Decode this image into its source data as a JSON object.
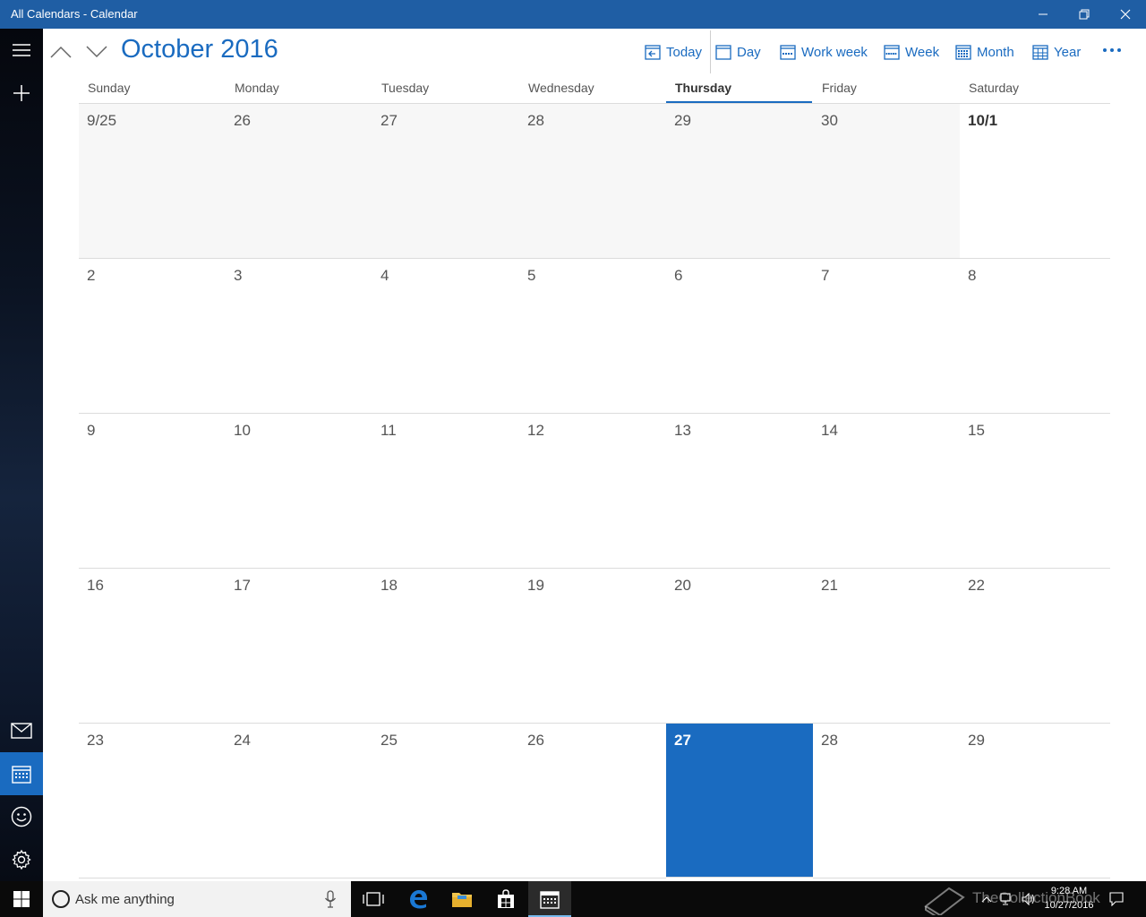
{
  "window": {
    "title": "All Calendars - Calendar",
    "controls": {
      "minimize": "minimize-icon",
      "restore": "restore-icon",
      "close": "close-icon"
    }
  },
  "rail": {
    "top": [
      "hamburger-menu-icon",
      "new-event-plus-icon"
    ],
    "bottom": [
      "mail-icon",
      "calendar-icon",
      "people-smiley-icon",
      "settings-gear-icon"
    ],
    "active": "calendar-icon"
  },
  "toolbar": {
    "month_title": "October 2016",
    "buttons": {
      "today": "Today",
      "day": "Day",
      "work_week": "Work week",
      "week": "Week",
      "month": "Month",
      "year": "Year"
    },
    "more": "more-ellipsis-icon"
  },
  "calendar": {
    "days_of_week": [
      "Sunday",
      "Monday",
      "Tuesday",
      "Wednesday",
      "Thursday",
      "Friday",
      "Saturday"
    ],
    "today_weekday": "Thursday",
    "weeks": [
      [
        "9/25",
        "26",
        "27",
        "28",
        "29",
        "30",
        "10/1"
      ],
      [
        "2",
        "3",
        "4",
        "5",
        "6",
        "7",
        "8"
      ],
      [
        "9",
        "10",
        "11",
        "12",
        "13",
        "14",
        "15"
      ],
      [
        "16",
        "17",
        "18",
        "19",
        "20",
        "21",
        "22"
      ],
      [
        "23",
        "24",
        "25",
        "26",
        "27",
        "28",
        "29"
      ]
    ],
    "today_date": "27",
    "accent_color": "#1a6bc0",
    "other_month_color": "#f7f7f7"
  },
  "taskbar": {
    "search_placeholder": "Ask me anything",
    "tray_time": "9:28 AM",
    "tray_date": "10/27/2016",
    "watermark": "TheCollectionBook"
  }
}
